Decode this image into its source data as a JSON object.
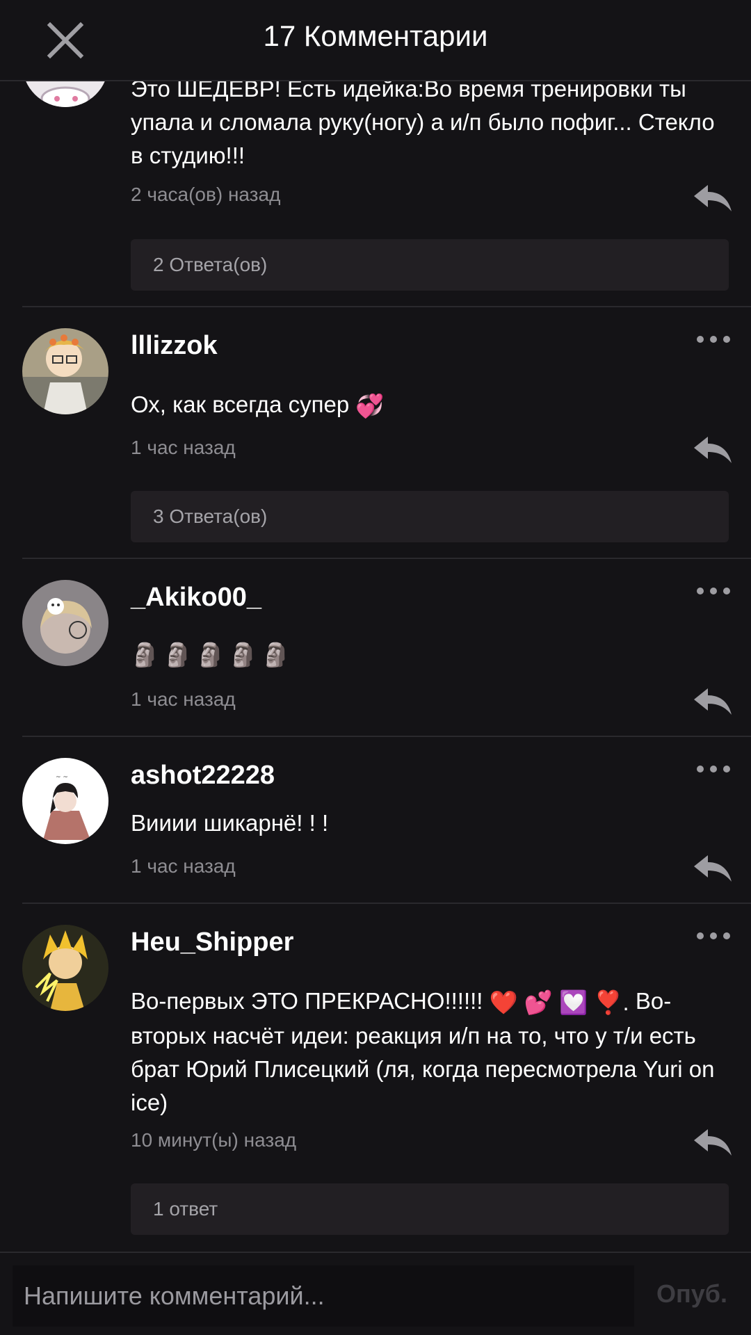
{
  "header": {
    "title": "17 Комментарии",
    "close_icon": "close-icon"
  },
  "comments": [
    {
      "username": "",
      "text": "Это ШЕДЕВР! Есть идейка:Во время тренировки ты упала и сломала руку(ногу) а и/п было пофиг... Стекло в студию!!!",
      "time": "2 часа(ов) назад",
      "replies": "2 Ответа(ов)"
    },
    {
      "username": "lllizzok",
      "text": "Ох, как всегда супер",
      "emoji": "💞",
      "time": "1 час назад",
      "replies": "3 Ответа(ов)"
    },
    {
      "username": "_Akiko00_",
      "text": "🗿🗿🗿🗿🗿",
      "time": "1 час назад"
    },
    {
      "username": "ashot22228",
      "text": "Вииии шикарнё! ! !",
      "time": "1 час назад"
    },
    {
      "username": "Heu_Shipper",
      "text_line1": "Во-первых ЭТО ПРЕКРАСНО!!!!!! ",
      "emojis": "❤️ 💕 💟 ❣️.",
      "text_rest": "Во-вторых насчёт идеи: реакция и/п на то, что у  т/и есть брат Юрий Плисецкий (ля, когда пересмотрела Yuri on ice)",
      "time": "10 минут(ы) назад",
      "replies": "1 ответ"
    }
  ],
  "composer": {
    "placeholder": "Напишите комментарий...",
    "publish_label": "Опуб."
  },
  "colors": {
    "background": "#141316",
    "reply_box": "#221f23",
    "muted_text": "#8e8d92"
  }
}
